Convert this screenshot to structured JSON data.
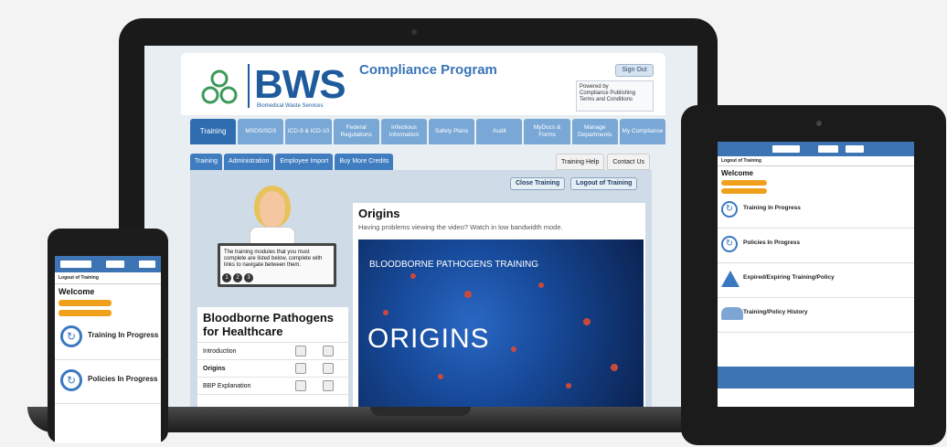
{
  "laptop": {
    "logo_text": "BWS",
    "logo_subtitle": "Biomedical Waste Services",
    "app_title": "Compliance Program",
    "sign_out": "Sign Out",
    "powered": {
      "line1": "Powered by",
      "line2": "Compliance Publishing",
      "line3": "Terms and Conditions"
    },
    "nav": [
      {
        "label": "Training",
        "active": true
      },
      {
        "label": "MSDS/SDS"
      },
      {
        "label": "ICD-9 & ICD-10"
      },
      {
        "label": "Federal Regulations"
      },
      {
        "label": "Infectious Information"
      },
      {
        "label": "Safety Plans"
      },
      {
        "label": "Audit"
      },
      {
        "label": "MyDocs & Forms"
      },
      {
        "label": "Manage Departments"
      },
      {
        "label": "My Compliance"
      }
    ],
    "subnav": [
      "Training",
      "Administration",
      "Employee Import",
      "Buy More Credits"
    ],
    "help_tabs": [
      "Training Help",
      "Contact Us"
    ],
    "buttons": {
      "close_training": "Close Training",
      "logout_training": "Logout of Training"
    },
    "mascot_text": "The training modules that you must complete are listed below, complete with links to navigate between them.",
    "mascot_dots": [
      "1",
      "2",
      "3"
    ],
    "course_title": "Bloodborne Pathogens for Healthcare",
    "modules": [
      "Introduction",
      "Origins",
      "BBP Explanation"
    ],
    "panel_title": "Origins",
    "panel_sub": "Having problems viewing the video? Watch in low bandwidth mode.",
    "video_heading": "BLOODBORNE PATHOGENS TRAINING",
    "video_big": "ORIGINS"
  },
  "tablet": {
    "logout": "Logout of Training",
    "welcome": "Welcome",
    "sections": [
      {
        "label": "Training In Progress",
        "icon": "refresh-icon"
      },
      {
        "label": "Policies In Progress",
        "icon": "refresh-icon"
      },
      {
        "label": "Expired/Expiring Training/Policy",
        "icon": "warning-icon"
      },
      {
        "label": "Training/Policy History",
        "icon": "people-icon"
      }
    ]
  },
  "phone": {
    "logout": "Logout of Training",
    "welcome": "Welcome",
    "sections": [
      {
        "label": "Training In Progress"
      },
      {
        "label": "Policies In Progress"
      }
    ]
  }
}
